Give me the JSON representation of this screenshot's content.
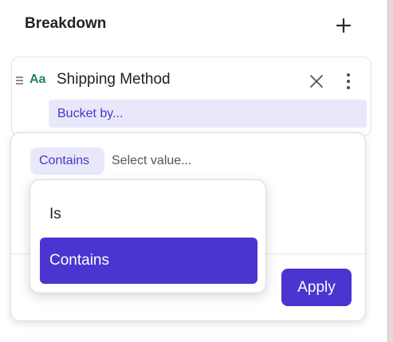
{
  "breakdown": {
    "title": "Breakdown",
    "add_icon": "plus-icon"
  },
  "property": {
    "type_badge": "Aa",
    "name": "Shipping Method",
    "remove_icon": "close-icon",
    "more_icon": "more-vertical-icon",
    "drag_icon": "drag-handle-icon",
    "bucket_label": "Bucket by..."
  },
  "filter": {
    "operator": "Contains",
    "value_placeholder": "Select value...",
    "apply_label": "Apply",
    "options": [
      "Is",
      "Contains"
    ],
    "selected_option": "Contains"
  },
  "colors": {
    "accent": "#4a35d1",
    "accent_light": "#e9e8fb",
    "accent_text": "#4338ca",
    "type_badge": "#1e8a5a"
  }
}
